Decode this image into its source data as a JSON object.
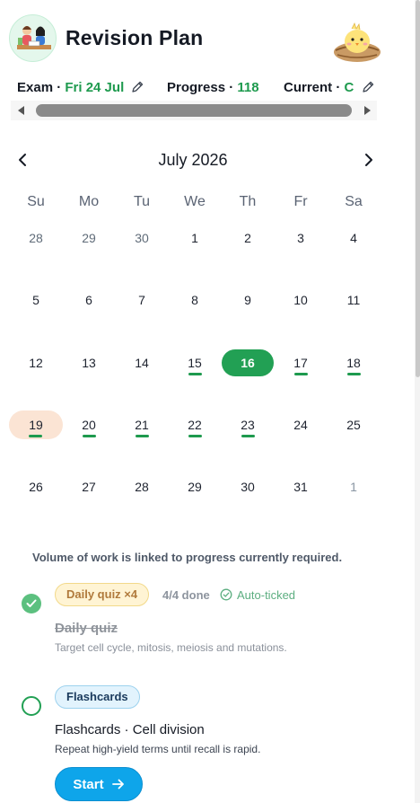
{
  "header": {
    "title": "Revision Plan",
    "avatar_icon": "students-studying-icon",
    "mascot_icon": "chick-in-nest-icon"
  },
  "info": {
    "exam_label": "Exam ·",
    "exam_value": "Fri 24 Jul",
    "progress_label": "Progress ·",
    "progress_value": "118",
    "current_label": "Current ·",
    "current_value": "C"
  },
  "calendar": {
    "month_label": "July 2026",
    "weekdays": [
      "Su",
      "Mo",
      "Tu",
      "We",
      "Th",
      "Fr",
      "Sa"
    ],
    "weeks": [
      [
        "28",
        "29",
        "30",
        "1",
        "2",
        "3",
        "4"
      ],
      [
        "5",
        "6",
        "7",
        "8",
        "9",
        "10",
        "11"
      ],
      [
        "12",
        "13",
        "14",
        "15",
        "16",
        "17",
        "18"
      ],
      [
        "19",
        "20",
        "21",
        "22",
        "23",
        "24",
        "25"
      ],
      [
        "26",
        "27",
        "28",
        "29",
        "30",
        "31",
        "1"
      ]
    ],
    "today": "16",
    "selected": "19",
    "marked_days": [
      "15",
      "17",
      "18",
      "19",
      "20",
      "21",
      "22",
      "23"
    ]
  },
  "note": "Volume of work is linked to progress currently required.",
  "tasks": [
    {
      "chip": "Daily quiz ×4",
      "meta": "4/4 done",
      "auto": "Auto-ticked",
      "title": "Daily quiz",
      "desc": "Target cell cycle, mitosis, meiosis and mutations.",
      "done": true
    },
    {
      "chip": "Flashcards",
      "title": "Flashcards · Cell division",
      "desc": "Repeat high-yield terms until recall is rapid.",
      "button": "Start",
      "done": false
    }
  ],
  "colors": {
    "accent_green": "#22a054",
    "selected_peach": "#fbe4d4",
    "button_blue": "#0ea5ea"
  }
}
